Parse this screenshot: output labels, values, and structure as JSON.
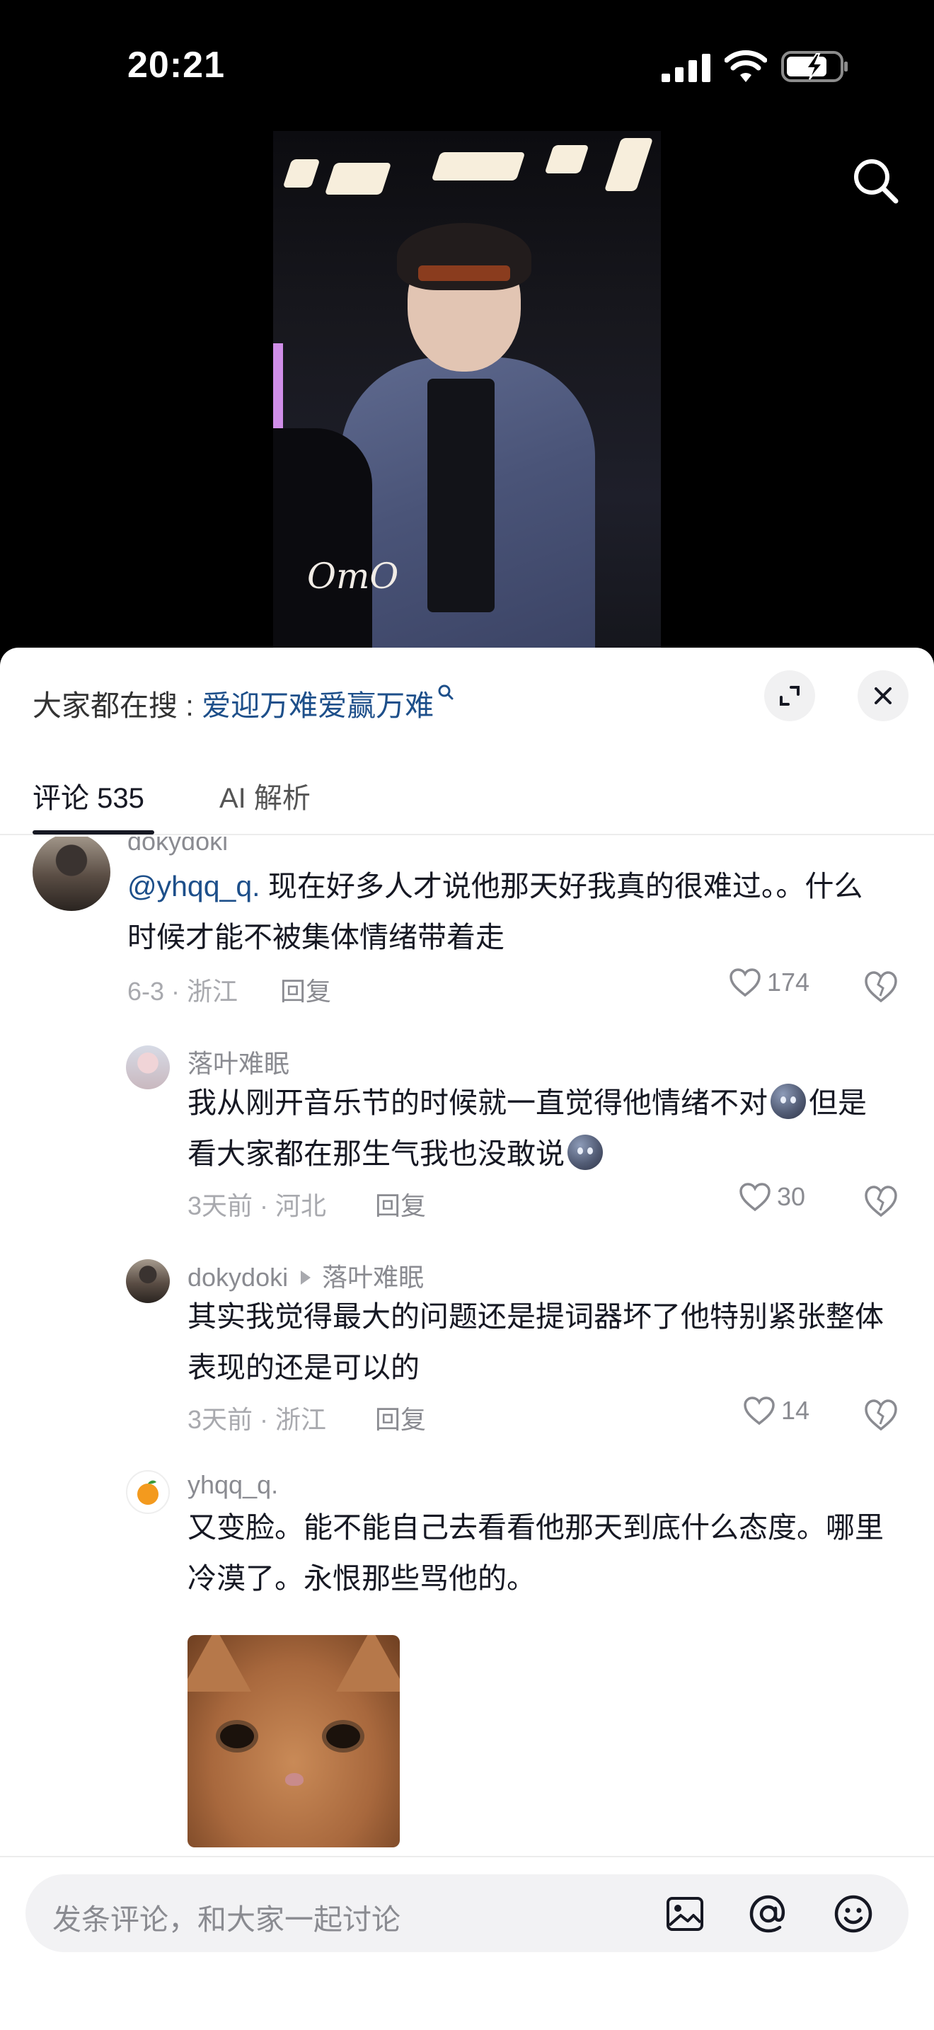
{
  "status_bar": {
    "time": "20:21"
  },
  "video": {
    "watermark": "OmO"
  },
  "sheet": {
    "trending_label": "大家都在搜 : ",
    "trending_term": "爱迎万难爱赢万难",
    "tabs": [
      {
        "label": "评论 535",
        "active": true
      },
      {
        "label": "AI 解析",
        "active": false
      }
    ]
  },
  "comments": [
    {
      "username": "dokydoki",
      "mention": "@yhqq_q.",
      "text": " 现在好多人才说他那天好我真的很难过。。什么时候才能不被集体情绪带着走",
      "meta": "6-3 · 浙江",
      "reply_label": "回复",
      "likes": "174"
    },
    {
      "username": "落叶难眠",
      "text_1": "我从刚开音乐节的时候就一直觉得他情绪不对",
      "text_2": "但是看大家都在那生气我也没敢说",
      "meta": "3天前 · 河北",
      "reply_label": "回复",
      "likes": "30"
    },
    {
      "username": "dokydoki",
      "reply_to": "落叶难眠",
      "text": "其实我觉得最大的问题还是提词器坏了他特别紧张整体表现的还是可以的",
      "meta": "3天前 · 浙江",
      "reply_label": "回复",
      "likes": "14"
    },
    {
      "username": "yhqq_q.",
      "text": "又变脸。能不能自己去看看他那天到底什么态度。哪里冷漠了。永恨那些骂他的。",
      "has_image": true
    }
  ],
  "input_bar": {
    "placeholder": "发条评论，和大家一起讨论"
  },
  "colors": {
    "link": "#1d4f8a",
    "text": "#161823",
    "muted": "#8a8b91"
  }
}
